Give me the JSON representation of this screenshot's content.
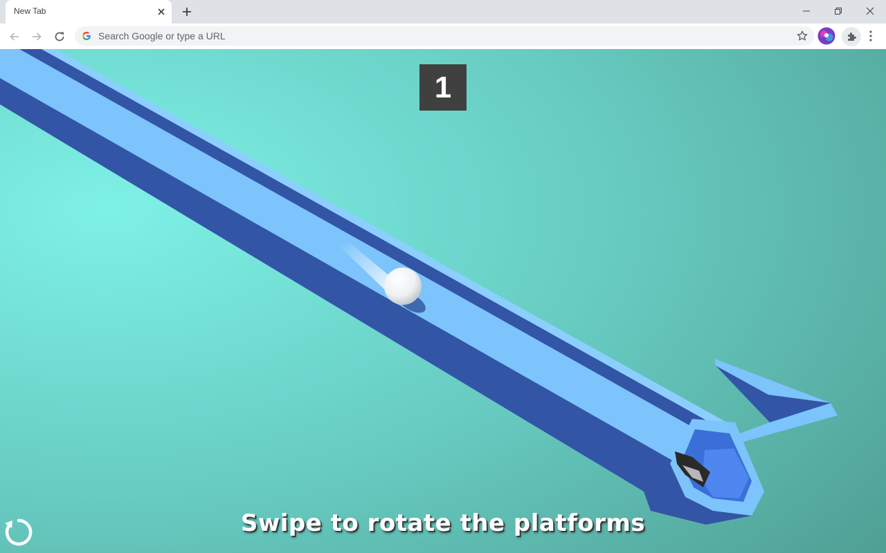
{
  "browser": {
    "tab_title": "New Tab",
    "omnibox_placeholder": "Search Google or type a URL",
    "icons": [
      "close-icon",
      "plus-icon",
      "minimize-icon",
      "restore-icon",
      "back-icon",
      "forward-icon",
      "reload-icon",
      "google-icon",
      "star-icon",
      "profile-avatar",
      "extensions-icon",
      "more-icon"
    ]
  },
  "game": {
    "level": "1",
    "hint": "Swipe to rotate the platforms",
    "background_colors": {
      "light": "#7ae9e0",
      "dark": "#52a196"
    },
    "track_colors": {
      "top": "#7cc4fb",
      "side": "#3355a6",
      "inner": "#4f86ef"
    },
    "icons": [
      "restart-icon"
    ]
  }
}
